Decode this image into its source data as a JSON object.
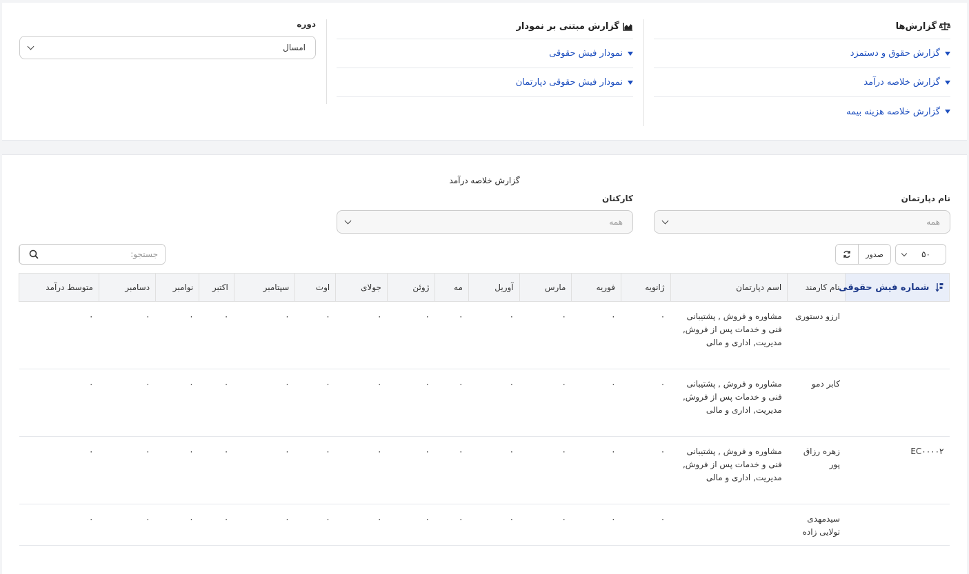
{
  "reports": {
    "title": "گزارش‌ها",
    "links": [
      "گزارش حقوق و دستمزد",
      "گزارش خلاصه درآمد",
      "گزارش خلاصه هزینه بیمه"
    ]
  },
  "charts": {
    "title": "گزارش مبتنی بر نمودار",
    "links": [
      "نمودار فیش حقوقی",
      "نمودار فیش حقوقی دپارتمان"
    ]
  },
  "period": {
    "label": "دوره",
    "value": "امسال"
  },
  "report": {
    "title": "گزارش خلاصه درآمد"
  },
  "filters": {
    "department_label": "نام دپارتمان",
    "department_value": "همه",
    "staff_label": "کارکنان",
    "staff_value": "همه"
  },
  "toolbar": {
    "page_size": "۵۰",
    "export_label": "صدور",
    "search_placeholder": "جستجو:"
  },
  "table": {
    "columns": [
      "شماره فیش حقوقی",
      "نام کارمند",
      "اسم دپارتمان",
      "ژانویه",
      "فوریه",
      "مارس",
      "آوریل",
      "مه",
      "ژوئن",
      "جولای",
      "اوت",
      "سپتامبر",
      "اکتبر",
      "نوامبر",
      "دسامبر",
      "متوسط درآمد"
    ],
    "rows": [
      [
        "",
        "ارزو دستوری",
        "مشاوره و فروش , پشتیبانی فنی و خدمات پس از فروش, مدیریت, اداری و مالی",
        "۰",
        "۰",
        "۰",
        "۰",
        "۰",
        "۰",
        "۰",
        "۰",
        "۰",
        "۰",
        "۰",
        "۰",
        "۰"
      ],
      [
        "",
        "کابر دمو",
        "مشاوره و فروش , پشتیبانی فنی و خدمات پس از فروش, مدیریت, اداری و مالی",
        "۰",
        "۰",
        "۰",
        "۰",
        "۰",
        "۰",
        "۰",
        "۰",
        "۰",
        "۰",
        "۰",
        "۰",
        "۰"
      ],
      [
        "EC۰۰۰۰۲",
        "زهره رزاق پور",
        "مشاوره و فروش , پشتیبانی فنی و خدمات پس از فروش, مدیریت, اداری و مالی",
        "۰",
        "۰",
        "۰",
        "۰",
        "۰",
        "۰",
        "۰",
        "۰",
        "۰",
        "۰",
        "۰",
        "۰",
        "۰"
      ],
      [
        "",
        "سیدمهدی تولایی زاده",
        "",
        "۰",
        "۰",
        "۰",
        "۰",
        "۰",
        "۰",
        "۰",
        "۰",
        "۰",
        "۰",
        "۰",
        "۰",
        "۰"
      ]
    ]
  },
  "colors": {
    "link": "#1e4fbf",
    "border": "#e0e0e0",
    "header_bg": "#f3f4f6"
  }
}
